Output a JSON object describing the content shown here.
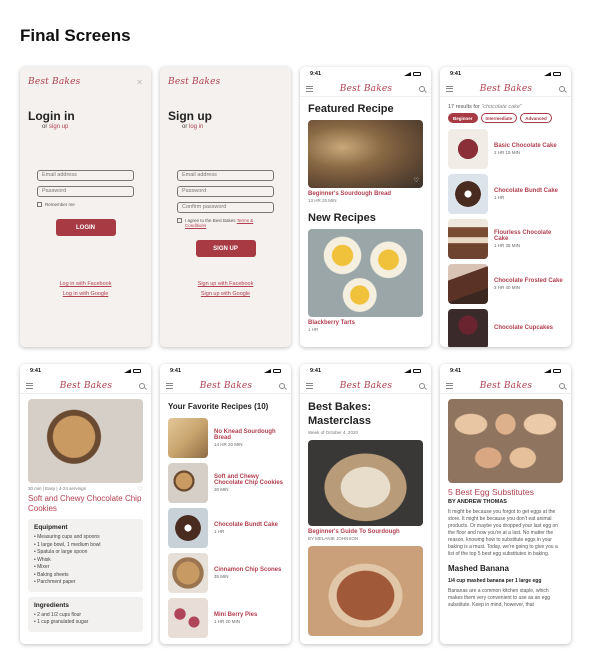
{
  "page_title": "Final Screens",
  "brand": "Best Bakes",
  "status_time": "9:41",
  "login": {
    "title": "Login in",
    "sub_prefix": "or",
    "sub_link": "sign up",
    "email_placeholder": "Email address",
    "password_placeholder": "Password",
    "remember": "Remember me",
    "button": "LOGIN",
    "facebook": "Log in with Facebook",
    "google": "Log in with Google"
  },
  "signup": {
    "title": "Sign up",
    "sub_prefix": "or",
    "sub_link": "log in",
    "email_placeholder": "Email address",
    "password_placeholder": "Password",
    "confirm_placeholder": "Confirm password",
    "agree_text": "I agree to the Best Bakes",
    "agree_link": "Terms & Conditions",
    "button": "SIGN UP",
    "facebook": "Sign up with Facebook",
    "google": "Sign up with Google"
  },
  "featured": {
    "section1": "Featured Recipe",
    "item1_title": "Beginner's Sourdough Bread",
    "item1_meta": "13 HR 25 MIN",
    "section2": "New Recipes",
    "item2_title": "Blackberry Tarts",
    "item2_meta": "1 HR"
  },
  "search": {
    "results_count": "17 results for",
    "results_query": "\"chocolate cake\"",
    "chips": [
      "Beginner",
      "Intermediate",
      "Advanced"
    ],
    "items": [
      {
        "title": "Basic Chocolate Cake",
        "meta": "2 HR 15 MIN"
      },
      {
        "title": "Chocolate Bundt Cake",
        "meta": "1 HR"
      },
      {
        "title": "Flourless Chocolate Cake",
        "meta": "1 HR 35 MIN"
      },
      {
        "title": "Chocolate Frosted Cake",
        "meta": "2 HR 40 MIN"
      },
      {
        "title": "Chocolate Cupcakes",
        "meta": ""
      }
    ]
  },
  "recipe": {
    "meta": "30 min | Easy | 4-24 servings",
    "title": "Soft and Chewy Chocolate Chip Cookies",
    "equipment_title": "Equipment",
    "equipment": [
      "Measuring cups and spoons",
      "1 large bowl, 1 medium bowl",
      "Spatula or large spoon",
      "Whisk",
      "Mixer",
      "Baking sheets",
      "Parchment paper"
    ],
    "ingredients_title": "Ingredients",
    "ingredients": [
      "2 and 1/2 cups flour",
      "1 cup granulated sugar"
    ]
  },
  "favorites": {
    "title": "Your Favorite Recipes (10)",
    "items": [
      {
        "title": "No Knead Sourdough Bread",
        "meta": "14 HR 20 MIN"
      },
      {
        "title": "Soft and Chewy Chocolate Chip Cookies",
        "meta": "30 MIN"
      },
      {
        "title": "Chocolate Bundt Cake",
        "meta": "1 HR"
      },
      {
        "title": "Cinnamon Chip Scones",
        "meta": "35 MIN"
      },
      {
        "title": "Mini Berry Pies",
        "meta": "1 HR 20 MIN"
      }
    ]
  },
  "masterclass": {
    "title": "Best Bakes: Masterclass",
    "week": "Week of October 4, 2020",
    "item_title": "Beginner's Guide To Sourdough",
    "item_meta": "BY MELANIE JOHNSON"
  },
  "article": {
    "title": "5 Best Egg Substitutes",
    "byline": "BY ANDREW THOMAS",
    "intro": "It might be because you forgot to get eggs at the store. It might be because you don't eat animal products. Or maybe you dropped your last egg on the floor and now you're at a last. No matter the reason, knowing how to substitute eggs in your baking is a must. Today, we're going to give you a list of the top 5 best egg substitutes in baking.",
    "section": "Mashed Banana",
    "section_sub": "1/4 cup mashed banana per 1 large egg",
    "section_body": "Bananas are a common kitchen staple, which makes them very convenient to use as an egg substitute. Keep in mind, however, that"
  }
}
